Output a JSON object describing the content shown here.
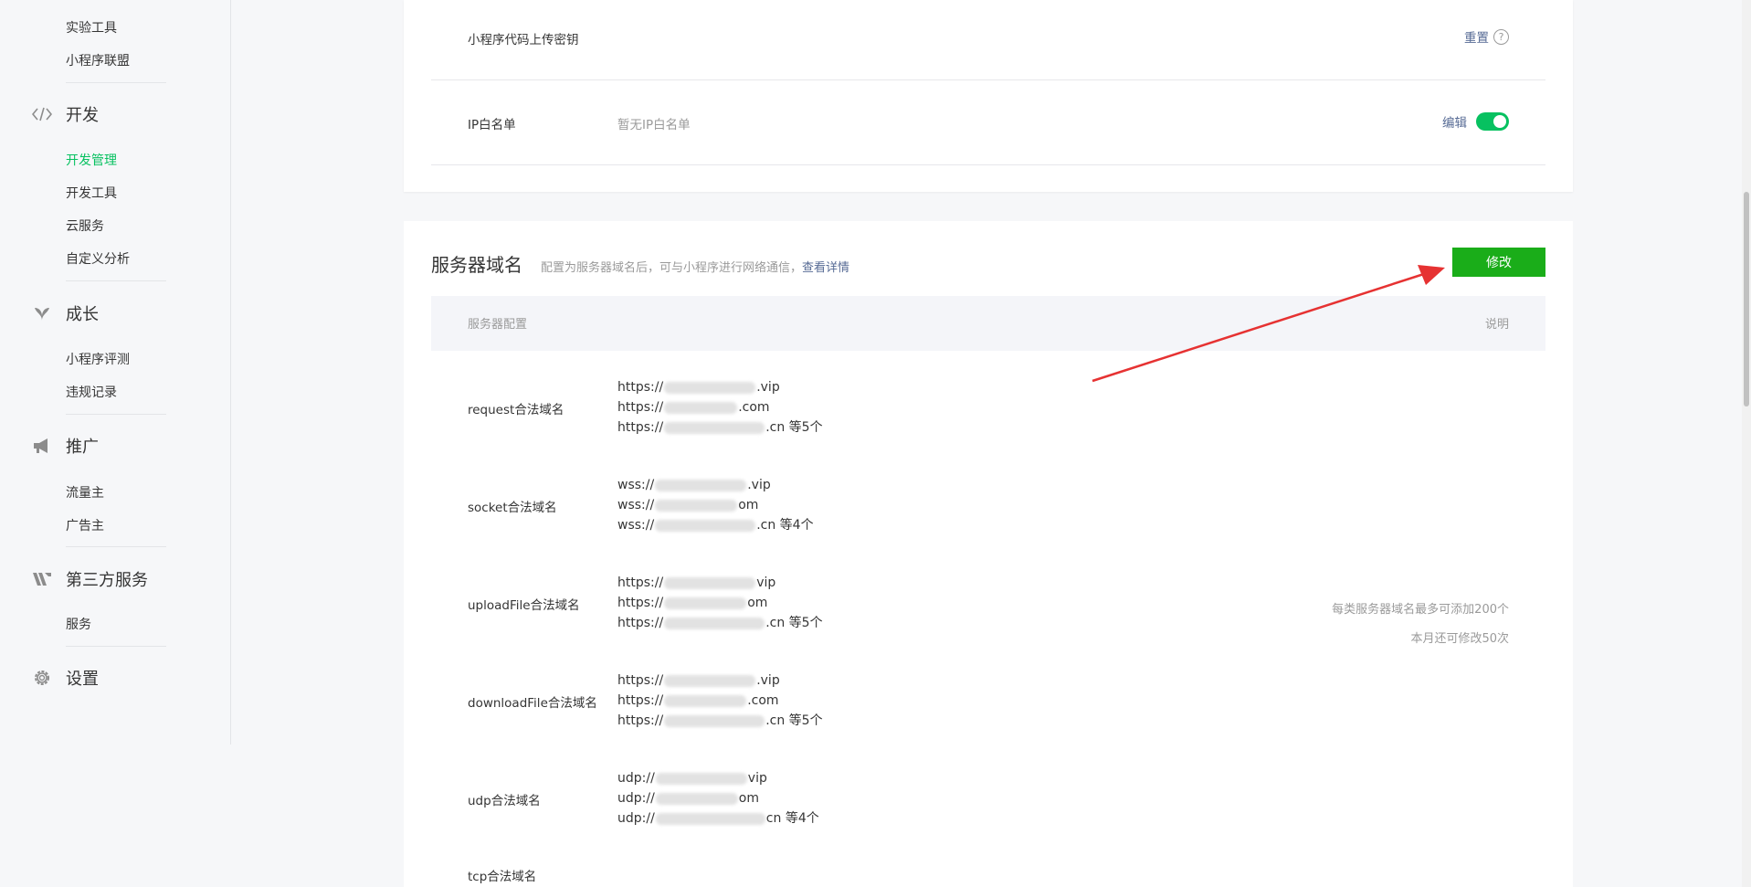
{
  "sidebar": {
    "top_items": [
      "实验工具",
      "小程序联盟"
    ],
    "sections": [
      {
        "title": "开发",
        "icon": "code-icon",
        "items": [
          "开发管理",
          "开发工具",
          "云服务",
          "自定义分析"
        ],
        "active": 0
      },
      {
        "title": "成长",
        "icon": "leaf-icon",
        "items": [
          "小程序评测",
          "违规记录"
        ]
      },
      {
        "title": "推广",
        "icon": "megaphone-icon",
        "items": [
          "流量主",
          "广告主"
        ]
      },
      {
        "title": "第三方服务",
        "icon": "third-party-icon",
        "items": [
          "服务"
        ]
      },
      {
        "title": "设置",
        "icon": "gear-icon",
        "items": []
      }
    ]
  },
  "secret_row": {
    "label": "小程序代码上传密钥",
    "action": "重置",
    "help": "?"
  },
  "ip_row": {
    "label": "IP白名单",
    "value": "暂无IP白名单",
    "action": "编辑"
  },
  "server_domain": {
    "title": "服务器域名",
    "desc": "配置为服务器域名后，可与小程序进行网络通信，",
    "detail_link": "查看详情",
    "modify_button": "修改",
    "header_left": "服务器配置",
    "header_right": "说明",
    "rows": [
      {
        "name": "request合法域名",
        "lines": [
          [
            "https://",
            ".vip"
          ],
          [
            "https://",
            ".com"
          ],
          [
            "https://",
            ".cn 等5个"
          ]
        ]
      },
      {
        "name": "socket合法域名",
        "lines": [
          [
            "wss://",
            ".vip"
          ],
          [
            "wss://",
            "om"
          ],
          [
            "wss://",
            ".cn 等4个"
          ]
        ]
      },
      {
        "name": "uploadFile合法域名",
        "lines": [
          [
            "https://",
            "vip"
          ],
          [
            "https://",
            "om"
          ],
          [
            "https://",
            ".cn 等5个"
          ]
        ]
      },
      {
        "name": "downloadFile合法域名",
        "lines": [
          [
            "https://",
            ".vip"
          ],
          [
            "https://",
            ".com"
          ],
          [
            "https://",
            ".cn 等5个"
          ]
        ]
      },
      {
        "name": "udp合法域名",
        "lines": [
          [
            "udp://",
            "vip"
          ],
          [
            "udp://",
            "om"
          ],
          [
            "udp://",
            "cn 等4个"
          ]
        ]
      },
      {
        "name": "tcp合法域名",
        "lines": []
      }
    ],
    "note_line1": "每类服务器域名最多可添加200个",
    "note_line2": "本月还可修改50次"
  },
  "colors": {
    "accent_green": "#07c160",
    "button_green": "#1aad19",
    "link": "#576b95",
    "arrow": "#e63232"
  }
}
